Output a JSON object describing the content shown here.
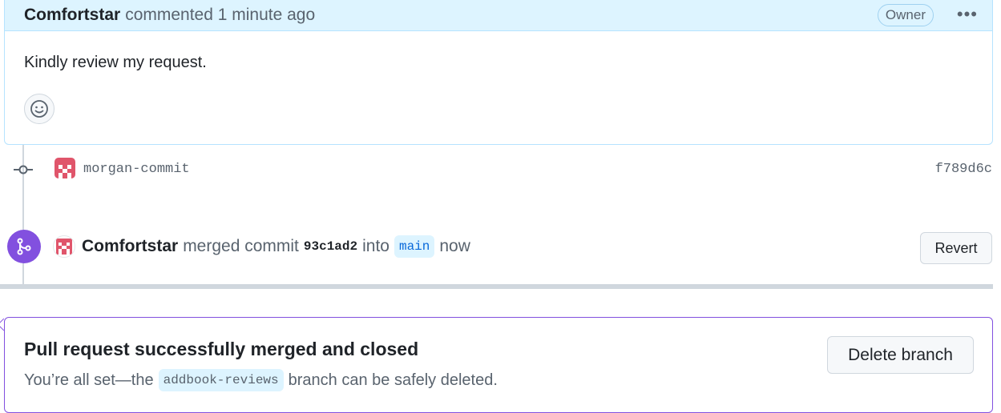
{
  "comment": {
    "author": "Comfortstar",
    "meta": "commented 1 minute ago",
    "badge": "Owner",
    "body": "Kindly review my request.",
    "menu_icon": "kebab-horizontal-icon",
    "reaction_icon": "smiley-icon"
  },
  "commit": {
    "icon": "git-commit-icon",
    "message": "morgan-commit",
    "sha": "f789d6c"
  },
  "merge_event": {
    "icon": "git-merge-icon",
    "author": "Comfortstar",
    "text_1": "merged commit",
    "commit_sha": "93c1ad2",
    "text_2": "into",
    "branch": "main",
    "text_3": "now",
    "revert_label": "Revert"
  },
  "merge_status": {
    "title": "Pull request successfully merged and closed",
    "sub_prefix": "You’re all set—the",
    "branch": "addbook-reviews",
    "sub_suffix": "branch can be safely deleted.",
    "delete_label": "Delete branch"
  },
  "colors": {
    "header_bg": "#ddf4ff",
    "merge_purple": "#8250df",
    "avatar_red": "#e0556b"
  }
}
